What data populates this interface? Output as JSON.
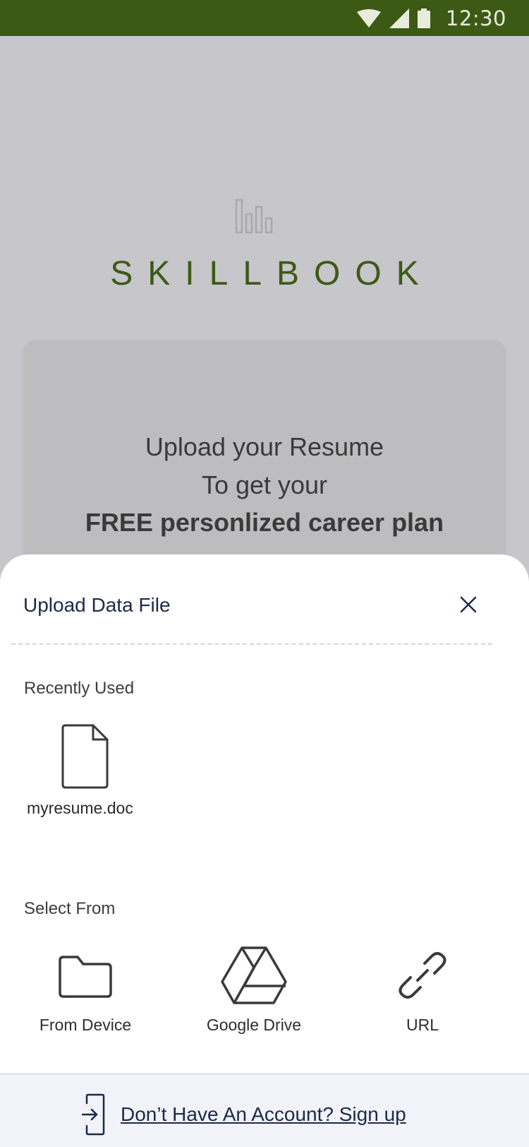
{
  "status_bar": {
    "time": "12:30",
    "icons": [
      "wifi-icon",
      "signal-icon",
      "battery-icon"
    ]
  },
  "brand": {
    "logo_icon": "bar-chart-icon",
    "name": "SKILLBOOK"
  },
  "card": {
    "line1": "Upload your Resume",
    "line2": "To get your",
    "line3": "FREE personlized career plan"
  },
  "sheet": {
    "title": "Upload Data File",
    "close_icon": "close-icon",
    "recently_used_label": "Recently Used",
    "recent_files": [
      {
        "name": "myresume.doc",
        "icon": "document-icon"
      }
    ],
    "select_from_label": "Select From",
    "sources": [
      {
        "label": "From Device",
        "icon": "folder-icon"
      },
      {
        "label": "Google Drive",
        "icon": "google-drive-icon"
      },
      {
        "label": "URL",
        "icon": "link-icon"
      }
    ]
  },
  "footer": {
    "signup_text": "Don’t Have An Account? Sign up",
    "signup_icon": "login-icon"
  },
  "colors": {
    "brand_green": "#3d5a14",
    "navy": "#1c2a4a",
    "overlay": "#c6c6cb"
  }
}
